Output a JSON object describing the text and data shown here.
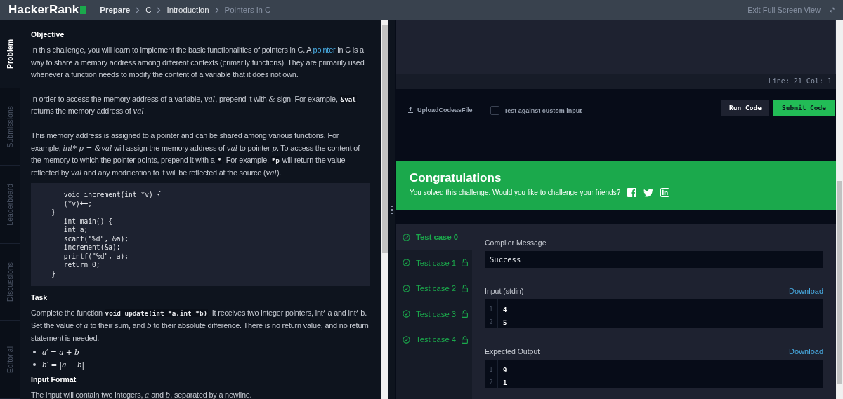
{
  "header": {
    "logo": "HackerRank",
    "breadcrumbs": [
      {
        "label": "Prepare",
        "selected": false
      },
      {
        "label": "C",
        "selected": false
      },
      {
        "label": "Introduction",
        "selected": false
      },
      {
        "label": "Pointers in C",
        "selected": true
      }
    ],
    "exit_link": "Exit Full Screen View"
  },
  "side_tabs": [
    {
      "label": "Problem",
      "selected": true
    },
    {
      "label": "Submissions",
      "selected": false
    },
    {
      "label": "Leaderboard",
      "selected": false
    },
    {
      "label": "Discussions",
      "selected": false
    },
    {
      "label": "Editorial",
      "selected": false
    }
  ],
  "problem": {
    "blocks": [
      {
        "kind": "heading",
        "text": "Objective"
      },
      {
        "kind": "paragraph",
        "parts": [
          {
            "kind": "text",
            "text": "In this challenge, you will learn to implement the basic functionalities of pointers in C. A "
          },
          {
            "kind": "link",
            "text": "pointer"
          },
          {
            "kind": "text",
            "text": " in C is a way to share a memory address among different contexts (primarily functions). They are primarily used whenever a function needs to modify the content of a variable that it does not own."
          }
        ]
      },
      {
        "kind": "paragraph",
        "parts": [
          {
            "kind": "text",
            "text": "In order to access the memory address of a variable, "
          },
          {
            "kind": "math",
            "text": "val"
          },
          {
            "kind": "text",
            "text": ", prepend it with "
          },
          {
            "kind": "math",
            "text": "&"
          },
          {
            "kind": "text",
            "text": " sign. For example, "
          },
          {
            "kind": "code",
            "text": "&val"
          },
          {
            "kind": "text",
            "text": " returns the memory address of "
          },
          {
            "kind": "math",
            "text": "val"
          },
          {
            "kind": "text",
            "text": "."
          }
        ]
      },
      {
        "kind": "paragraph",
        "parts": [
          {
            "kind": "text",
            "text": "This memory address is assigned to a pointer and can be shared among various functions. For example, "
          },
          {
            "kind": "math",
            "text": "int* p = &val"
          },
          {
            "kind": "text",
            "text": " will assign the memory address of "
          },
          {
            "kind": "math",
            "text": "val"
          },
          {
            "kind": "text",
            "text": " to pointer "
          },
          {
            "kind": "math",
            "text": "p"
          },
          {
            "kind": "text",
            "text": ". To access the content of the memory to which the pointer points, prepend it with a "
          },
          {
            "kind": "code",
            "text": "*"
          },
          {
            "kind": "text",
            "text": ". For example, "
          },
          {
            "kind": "code",
            "text": "*p"
          },
          {
            "kind": "text",
            "text": " will return the value reflected by "
          },
          {
            "kind": "math",
            "text": "val"
          },
          {
            "kind": "text",
            "text": " and any modification to it will be reflected at the source ("
          },
          {
            "kind": "math",
            "text": "val"
          },
          {
            "kind": "text",
            "text": ")."
          }
        ]
      },
      {
        "kind": "code",
        "lines": [
          "      void increment(int *v) {",
          "      (*v)++;",
          "   }",
          "      int main() {",
          "      int a;",
          "      scanf(\"%d\", &a);",
          "      increment(&a);",
          "      printf(\"%d\", a);",
          "      return 0;",
          "   }"
        ]
      },
      {
        "kind": "heading",
        "text": "Task"
      },
      {
        "kind": "paragraph",
        "parts": [
          {
            "kind": "text",
            "text": "Complete the function "
          },
          {
            "kind": "code",
            "text": "void update(int *a,int *b)"
          },
          {
            "kind": "text",
            "text": ". It receives two integer pointers, int* a and int* b. Set the value of "
          },
          {
            "kind": "math",
            "text": "a"
          },
          {
            "kind": "text",
            "text": " to their sum, and "
          },
          {
            "kind": "math",
            "text": "b"
          },
          {
            "kind": "text",
            "text": " to their absolute difference. There is no return value, and no return statement is needed."
          }
        ]
      },
      {
        "kind": "bullets",
        "items": [
          "*a′* = *a* + *b*",
          "*b′* = |*a* − *b*|"
        ]
      },
      {
        "kind": "heading",
        "text": "Input Format"
      },
      {
        "kind": "paragraph",
        "parts": [
          {
            "kind": "text",
            "text": "The input will contain two integers, "
          },
          {
            "kind": "math",
            "text": "a"
          },
          {
            "kind": "text",
            "text": " and "
          },
          {
            "kind": "math",
            "text": "b"
          },
          {
            "kind": "text",
            "text": ", separated by a newline."
          }
        ]
      }
    ]
  },
  "editor": {
    "status": "Line: 21 Col: 1"
  },
  "toolbar": {
    "upload": "UploadCodeasFile",
    "custom_input": {
      "label": "Test against custom input",
      "checked": false
    },
    "buttons": [
      {
        "label": "Run Code",
        "kind": "secondary"
      },
      {
        "label": "Submit Code",
        "kind": "primary"
      }
    ]
  },
  "banner": {
    "title": "Congratulations",
    "message": "You solved this challenge. Would you like to challenge your friends?"
  },
  "test_cases": [
    {
      "label": "Test case 0",
      "selected": true,
      "locked": false
    },
    {
      "label": "Test case 1",
      "selected": false,
      "locked": true
    },
    {
      "label": "Test case 2",
      "selected": false,
      "locked": true
    },
    {
      "label": "Test case 3",
      "selected": false,
      "locked": true
    },
    {
      "label": "Test case 4",
      "selected": false,
      "locked": true
    }
  ],
  "result": {
    "compiler_label": "Compiler Message",
    "compiler_message": "Success",
    "sections": [
      {
        "label": "Input (stdin)",
        "download": "Download",
        "lines": [
          {
            "number": "1",
            "text": "4"
          },
          {
            "number": "2",
            "text": "5"
          }
        ]
      },
      {
        "label": "Expected Output",
        "download": "Download",
        "lines": [
          {
            "number": "1",
            "text": "9"
          },
          {
            "number": "2",
            "text": "1"
          }
        ]
      }
    ]
  }
}
